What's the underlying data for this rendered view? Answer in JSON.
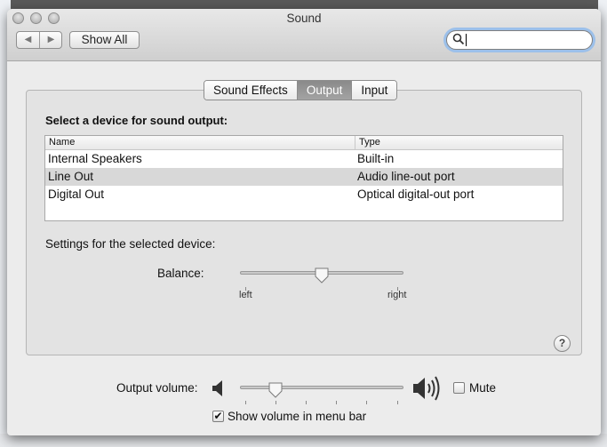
{
  "window": {
    "title": "Sound"
  },
  "toolbar": {
    "show_all_label": "Show All",
    "search_value": ""
  },
  "tabs": [
    {
      "label": "Sound Effects",
      "selected": false
    },
    {
      "label": "Output",
      "selected": true
    },
    {
      "label": "Input",
      "selected": false
    }
  ],
  "output": {
    "heading": "Select a device for sound output:",
    "columns": [
      "Name",
      "Type"
    ],
    "devices": [
      {
        "name": "Internal Speakers",
        "type": "Built-in",
        "selected": false
      },
      {
        "name": "Line Out",
        "type": "Audio line-out port",
        "selected": true
      },
      {
        "name": "Digital Out",
        "type": "Optical digital-out port",
        "selected": false
      }
    ],
    "settings_label": "Settings for the selected device:",
    "balance": {
      "label": "Balance:",
      "left_label": "left",
      "right_label": "right",
      "value": 0.5
    }
  },
  "help_label": "?",
  "volume": {
    "label": "Output volume:",
    "level": 0.22,
    "mute_label": "Mute",
    "mute_checked": false,
    "menu_bar_label": "Show volume in menu bar",
    "menu_bar_checked": true
  },
  "icons": {
    "back": "chevron-left-icon",
    "forward": "chevron-right-icon",
    "search": "search-icon",
    "speaker_low": "speaker-low-icon",
    "speaker_high": "speaker-high-icon",
    "check": "checkmark-icon"
  }
}
